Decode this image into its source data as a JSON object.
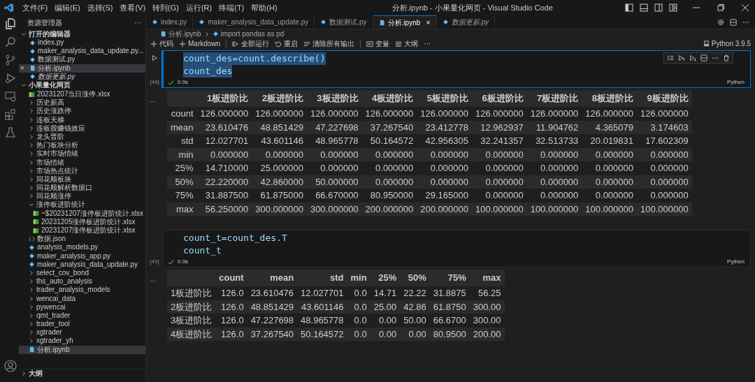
{
  "window": {
    "title": "分析.ipynb - 小果量化网页 - Visual Studio Code"
  },
  "menu": [
    "文件(F)",
    "编辑(E)",
    "选择(S)",
    "查看(V)",
    "转到(G)",
    "运行(R)",
    "终端(T)",
    "帮助(H)"
  ],
  "explorer": {
    "title": "资源管理器",
    "more": "···",
    "open_editors": {
      "title": "打开的编辑器",
      "expanded": true,
      "items": [
        {
          "label": "index.py",
          "kind": "py",
          "selected": false,
          "preview": false
        },
        {
          "label": "maker_analysis_data_update.py...",
          "kind": "py",
          "selected": false,
          "preview": false
        },
        {
          "label": "数据测试.py",
          "kind": "py",
          "selected": false,
          "preview": false
        },
        {
          "label": "分析.ipynb",
          "kind": "ipynb",
          "selected": true,
          "preview": false,
          "close": "×"
        },
        {
          "label": "数据更新.py",
          "kind": "py",
          "selected": false,
          "preview": true
        }
      ]
    },
    "folder": {
      "title": "小果量化网页",
      "expanded": true,
      "items": [
        {
          "label": "20231207当日涨停.xlsx",
          "kind": "xlsx",
          "selected": false
        },
        {
          "label": "历史新高",
          "kind": "folder",
          "expanded": false,
          "selected": false
        },
        {
          "label": "历史涨跌停",
          "kind": "folder",
          "expanded": false,
          "selected": false
        },
        {
          "label": "连板天梯",
          "kind": "folder",
          "expanded": false,
          "selected": false
        },
        {
          "label": "连板股赚钱效应",
          "kind": "folder",
          "expanded": false,
          "selected": false
        },
        {
          "label": "龙头晋阶",
          "kind": "folder",
          "expanded": false,
          "selected": false
        },
        {
          "label": "热门板块分析",
          "kind": "folder",
          "expanded": false,
          "selected": false
        },
        {
          "label": "实时市场情绪",
          "kind": "folder",
          "expanded": false,
          "selected": false
        },
        {
          "label": "市场情绪",
          "kind": "folder",
          "expanded": false,
          "selected": false
        },
        {
          "label": "市场热点统计",
          "kind": "folder",
          "expanded": false,
          "selected": false
        },
        {
          "label": "同花顺板块",
          "kind": "folder",
          "expanded": false,
          "selected": false
        },
        {
          "label": "同花顺解析数据口",
          "kind": "folder",
          "expanded": false,
          "selected": false
        },
        {
          "label": "同花顺涨停",
          "kind": "folder",
          "expanded": false,
          "selected": false
        },
        {
          "label": "涨停板进阶统计",
          "kind": "folder",
          "expanded": true,
          "selected": false,
          "children": [
            {
              "label": "~$20231207涨停板进阶统计.xlsx",
              "kind": "xlsx",
              "selected": false
            },
            {
              "label": "20231205涨停板进阶统计.xlsx",
              "kind": "xlsx",
              "selected": false
            },
            {
              "label": "20231207涨停板进阶统计.xlsx",
              "kind": "xlsx",
              "selected": false
            }
          ]
        },
        {
          "label": "数据.json",
          "kind": "json",
          "selected": false
        },
        {
          "label": "analysis_models.py",
          "kind": "py",
          "selected": false
        },
        {
          "label": "maker_analysis_app.py",
          "kind": "py",
          "selected": false
        },
        {
          "label": "maker_analysis_data_update.py",
          "kind": "py",
          "selected": false
        },
        {
          "label": "select_cov_bond",
          "kind": "folder",
          "expanded": false,
          "selected": false
        },
        {
          "label": "ths_auto_analysis",
          "kind": "folder",
          "expanded": false,
          "selected": false
        },
        {
          "label": "trader_analysis_models",
          "kind": "folder",
          "expanded": false,
          "selected": false
        },
        {
          "label": "wencai_data",
          "kind": "folder",
          "expanded": false,
          "selected": false
        },
        {
          "label": "pywencai",
          "kind": "folder",
          "expanded": false,
          "selected": false
        },
        {
          "label": "qmt_trader",
          "kind": "folder",
          "expanded": false,
          "selected": false
        },
        {
          "label": "trader_tool",
          "kind": "folder",
          "expanded": false,
          "selected": false
        },
        {
          "label": "xgtrader",
          "kind": "folder",
          "expanded": false,
          "selected": false
        },
        {
          "label": "xgtrader_yh",
          "kind": "folder",
          "expanded": false,
          "selected": false
        },
        {
          "label": "分析.ipynb",
          "kind": "ipynb",
          "selected": true
        }
      ]
    },
    "outline": {
      "title": "大纲",
      "expanded": false
    }
  },
  "tabs": [
    {
      "label": "index.py",
      "kind": "py",
      "selected": false,
      "preview": false
    },
    {
      "label": "maker_analysis_data_update.py",
      "kind": "py",
      "selected": false,
      "preview": false
    },
    {
      "label": "数据测试.py",
      "kind": "py",
      "selected": false,
      "preview": false
    },
    {
      "label": "分析.ipynb",
      "kind": "ipynb",
      "selected": true,
      "preview": false,
      "close": "×"
    },
    {
      "label": "数据更新.py",
      "kind": "py",
      "selected": false,
      "preview": true
    }
  ],
  "breadcrumb": [
    "分析.ipynb",
    "import pandas as pd"
  ],
  "toolbar": [
    {
      "label": "代码",
      "kind": "plus"
    },
    {
      "label": "Markdown",
      "kind": "plus"
    },
    {
      "label": "全部运行",
      "kind": "run"
    },
    {
      "label": "重启",
      "kind": "restart"
    },
    {
      "label": "清除所有输出",
      "kind": "clear"
    },
    {
      "label": "变量",
      "kind": "variables"
    },
    {
      "label": "大纲",
      "kind": "outline"
    },
    {
      "label": "···",
      "kind": "more"
    }
  ],
  "kernel": "Python 3.9.5",
  "cells": [
    {
      "selected": true,
      "count": "[48]",
      "time": "0.0s",
      "language": "Python",
      "code": [
        "count_des=count.describe()",
        "count_des"
      ],
      "output": {
        "more": "...",
        "columns": [
          "",
          "1板进阶比",
          "2板进阶比",
          "3板进阶比",
          "4板进阶比",
          "5板进阶比",
          "6板进阶比",
          "7板进阶比",
          "8板进阶比",
          "9板进阶比"
        ],
        "rows": [
          [
            "count",
            "126.000000",
            "126.000000",
            "126.000000",
            "126.000000",
            "126.000000",
            "126.000000",
            "126.000000",
            "126.000000",
            "126.000000"
          ],
          [
            "mean",
            "23.610476",
            "48.851429",
            "47.227698",
            "37.267540",
            "23.412778",
            "12.962937",
            "11.904762",
            "4.365079",
            "3.174603"
          ],
          [
            "std",
            "12.027701",
            "43.601146",
            "48.965778",
            "50.164572",
            "42.956305",
            "32.241357",
            "32.513733",
            "20.019831",
            "17.602309"
          ],
          [
            "min",
            "0.000000",
            "0.000000",
            "0.000000",
            "0.000000",
            "0.000000",
            "0.000000",
            "0.000000",
            "0.000000",
            "0.000000"
          ],
          [
            "25%",
            "14.710000",
            "25.000000",
            "0.000000",
            "0.000000",
            "0.000000",
            "0.000000",
            "0.000000",
            "0.000000",
            "0.000000"
          ],
          [
            "50%",
            "22.220000",
            "42.860000",
            "50.000000",
            "0.000000",
            "0.000000",
            "0.000000",
            "0.000000",
            "0.000000",
            "0.000000"
          ],
          [
            "75%",
            "31.887500",
            "61.875000",
            "66.670000",
            "80.950000",
            "29.165000",
            "0.000000",
            "0.000000",
            "0.000000",
            "0.000000"
          ],
          [
            "max",
            "56.250000",
            "300.000000",
            "300.000000",
            "200.000000",
            "200.000000",
            "100.000000",
            "100.000000",
            "100.000000",
            "100.000000"
          ]
        ]
      }
    },
    {
      "selected": false,
      "count": "[49]",
      "time": "0.0s",
      "language": "Python",
      "code": [
        "count_t=count_des.T",
        "count_t"
      ],
      "output": {
        "more": "...",
        "columns": [
          "",
          "count",
          "mean",
          "std",
          "min",
          "25%",
          "50%",
          "75%",
          "max"
        ],
        "rows": [
          [
            "1板进阶比",
            "126.0",
            "23.610476",
            "12.027701",
            "0.0",
            "14.71",
            "22.22",
            "31.8875",
            "56.25"
          ],
          [
            "2板进阶比",
            "126.0",
            "48.851429",
            "43.601146",
            "0.0",
            "25.00",
            "42.86",
            "61.8750",
            "300.00"
          ],
          [
            "3板进阶比",
            "126.0",
            "47.227698",
            "48.965778",
            "0.0",
            "0.00",
            "50.00",
            "66.6700",
            "300.00"
          ],
          [
            "4板进阶比",
            "126.0",
            "37.267540",
            "50.164572",
            "0.0",
            "0.00",
            "0.00",
            "80.9500",
            "200.00"
          ]
        ]
      }
    }
  ]
}
